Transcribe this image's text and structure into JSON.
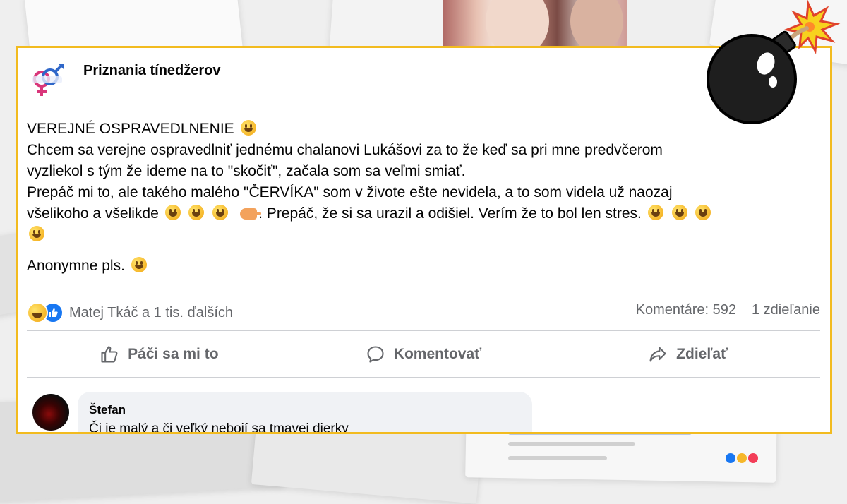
{
  "post": {
    "page_name": "Priznania tínedžerov",
    "title_line": "VEREJNÉ OSPRAVEDLNENIE",
    "line1": "Chcem sa verejne ospravedlniť jednému chalanovi Lukášovi za to že keď sa pri mne predvčerom",
    "line2": "vyzliekol s tým že ideme na to \"skočiť\", začala som sa veľmi smiať.",
    "line3": "Prepáč mi to, ale takého malého \"ČERVÍKA\" som v živote ešte nevidela, a to som videla už naozaj",
    "line4_a": "všelikoho a všelikde",
    "line4_b": ". Prepáč, že si sa urazil a odišiel. Verím že to bol len stres.",
    "signoff": "Anonymne  pls."
  },
  "reactions": {
    "names": "Matej Tkáč a 1 tis. ďalších",
    "comments": "Komentáre: 592",
    "shares": "1 zdieľanie"
  },
  "actions": {
    "like": "Páči sa mi to",
    "comment": "Komentovať",
    "share": "Zdieľať"
  },
  "comment": {
    "author": "Štefan",
    "text": "Či je malý a či veľký nebojí sa tmavej dierky"
  },
  "colors": {
    "frame": "#f2bb1f",
    "like_blue": "#1877f2",
    "muted_text": "#65676b",
    "comment_bg": "#f0f2f5"
  }
}
